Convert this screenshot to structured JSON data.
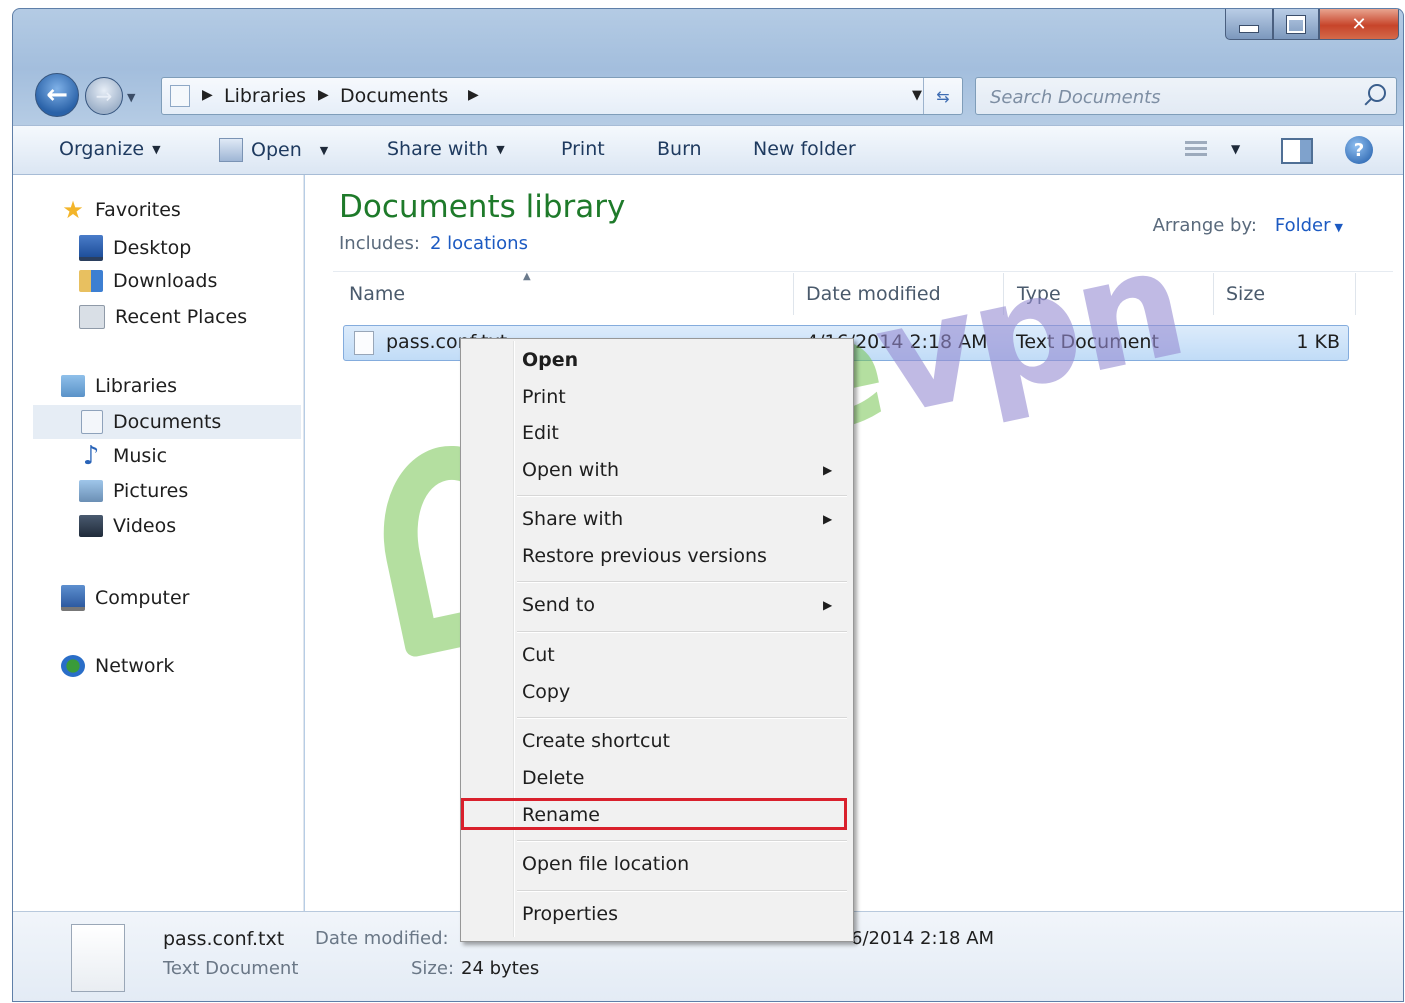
{
  "window": {
    "address": {
      "crumbs": [
        "Libraries",
        "Documents"
      ]
    },
    "search": {
      "placeholder": "Search Documents"
    }
  },
  "toolbar": {
    "organize": "Organize",
    "open": "Open",
    "share_with": "Share with",
    "print": "Print",
    "burn": "Burn",
    "new_folder": "New folder"
  },
  "nav": {
    "favorites": "Favorites",
    "desktop": "Desktop",
    "downloads": "Downloads",
    "recent_places": "Recent Places",
    "libraries": "Libraries",
    "documents": "Documents",
    "music": "Music",
    "pictures": "Pictures",
    "videos": "Videos",
    "computer": "Computer",
    "network": "Network"
  },
  "library": {
    "title": "Documents library",
    "includes_label": "Includes:",
    "locations_link": "2 locations",
    "arrange_label": "Arrange by:",
    "arrange_value": "Folder"
  },
  "columns": [
    "Name",
    "Date modified",
    "Type",
    "Size"
  ],
  "file": {
    "name": "pass.conf.txt",
    "date_modified": "4/16/2014 2:18 AM",
    "type": "Text Document",
    "size": "1 KB"
  },
  "context_menu": {
    "open": "Open",
    "print": "Print",
    "edit": "Edit",
    "open_with": "Open with",
    "share_with": "Share with",
    "restore": "Restore previous versions",
    "send_to": "Send to",
    "cut": "Cut",
    "copy": "Copy",
    "create_shortcut": "Create shortcut",
    "delete": "Delete",
    "rename": "Rename",
    "open_file_location": "Open file location",
    "properties": "Properties"
  },
  "details": {
    "name": "pass.conf.txt",
    "type": "Text Document",
    "date_modified_label": "Date modified:",
    "date_created_partial": "6/2014 2:18 AM",
    "size_label": "Size:",
    "size_value": "24 bytes"
  },
  "watermark": {
    "text_a": "pure",
    "text_b": "vpn"
  },
  "colors": {
    "library_title": "#1e7a2a",
    "link": "#1c5ac2",
    "highlight": "#d9202c"
  }
}
